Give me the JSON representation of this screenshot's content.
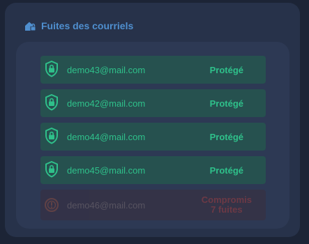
{
  "header": {
    "title": "Fuites des courriels",
    "icon": "house-lock-icon"
  },
  "colors": {
    "accent": "#4f8fcf",
    "protected": "#2fc08a",
    "compromised": "#a03a3a"
  },
  "emails": [
    {
      "address": "demo43@mail.com",
      "status": "Protégé",
      "icon": "shield-lock-icon"
    },
    {
      "address": "demo42@mail.com",
      "status": "Protégé",
      "icon": "shield-lock-icon"
    },
    {
      "address": "demo44@mail.com",
      "status": "Protégé",
      "icon": "shield-lock-icon"
    },
    {
      "address": "demo45@mail.com",
      "status": "Protégé",
      "icon": "shield-lock-icon"
    },
    {
      "address": "demo46@mail.com",
      "status_line1": "Compromis",
      "status_line2": "7 fuites",
      "icon": "alert-circle-icon"
    }
  ]
}
